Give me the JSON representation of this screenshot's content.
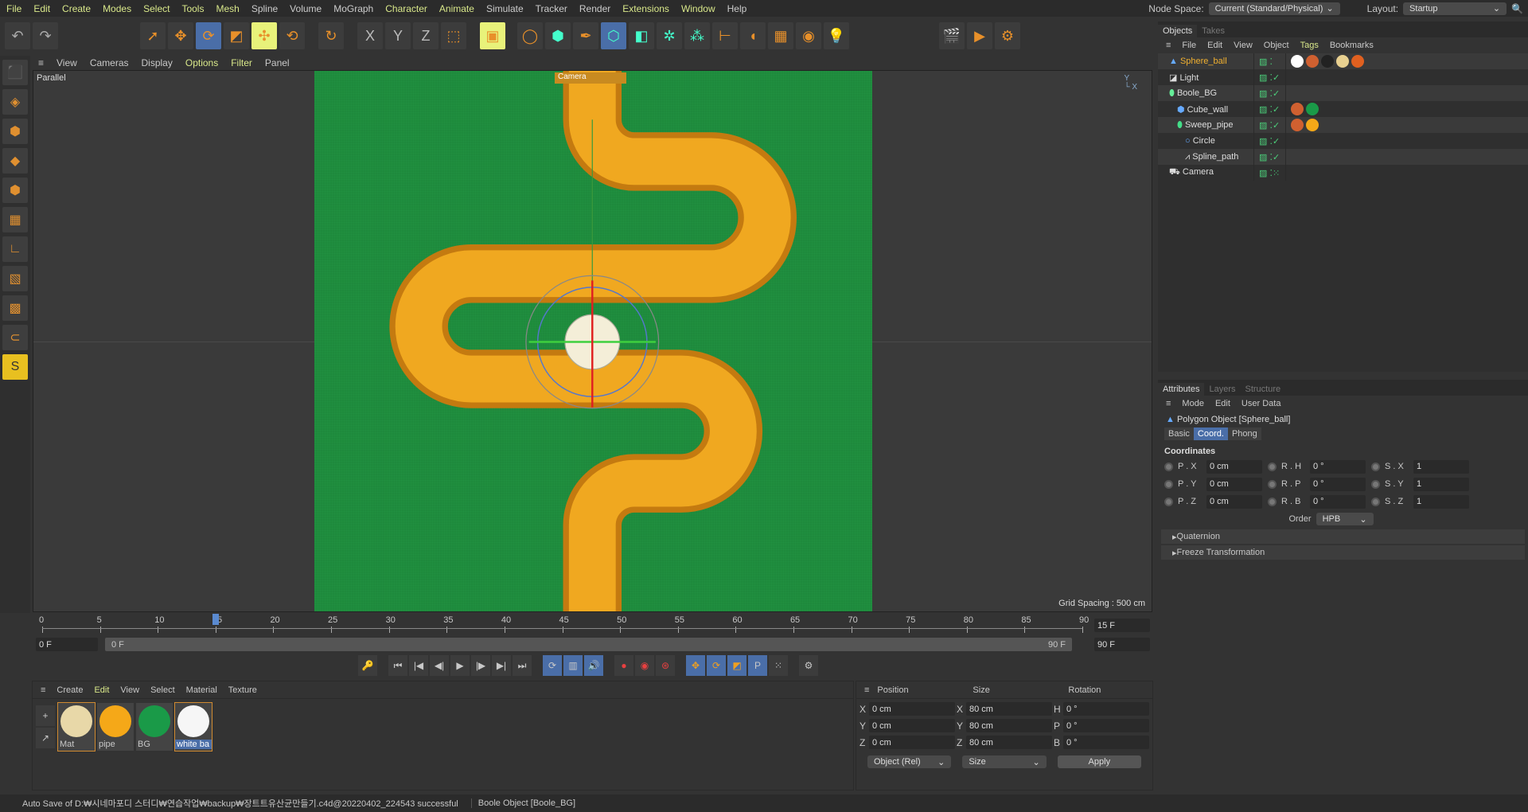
{
  "menu": [
    "File",
    "Edit",
    "Create",
    "Modes",
    "Select",
    "Tools",
    "Mesh",
    "Spline",
    "Volume",
    "MoGraph",
    "Character",
    "Animate",
    "Simulate",
    "Tracker",
    "Render",
    "Extensions",
    "Window",
    "Help"
  ],
  "menu_highlight": [
    "File",
    "Edit",
    "Create",
    "Modes",
    "Select",
    "Tools",
    "Mesh",
    "Character",
    "Animate",
    "Extensions",
    "Window"
  ],
  "node_space": {
    "label": "Node Space:",
    "value": "Current (Standard/Physical)"
  },
  "layout": {
    "label": "Layout:",
    "value": "Startup"
  },
  "toolbar": {
    "groups": [
      [
        "undo-icon",
        "redo-icon"
      ],
      [
        "live-select-icon",
        "move-icon",
        "rotate-icon",
        "scale-icon",
        "axis-move-icon",
        "transform-icon"
      ],
      [
        "recent-rotate-icon"
      ],
      [
        "x-axis-icon",
        "y-axis-icon",
        "z-axis-icon",
        "coordinate-system-icon"
      ],
      [
        "render-region-icon"
      ],
      [
        "spline-pen-icon",
        "cube-icon",
        "pen-icon",
        "subdivision-icon",
        "extrude-icon",
        "cloner-icon",
        "array-icon",
        "symmetry-icon",
        "deformer-icon",
        "floor-icon",
        "camera-icon",
        "light-icon"
      ],
      [
        "render-view-icon",
        "render-icon",
        "render-settings-icon"
      ]
    ],
    "glyphs": {
      "undo-icon": "↶",
      "redo-icon": "↷",
      "live-select-icon": "➚",
      "move-icon": "✥",
      "rotate-icon": "⟳",
      "scale-icon": "◩",
      "axis-move-icon": "✣",
      "transform-icon": "⟲",
      "recent-rotate-icon": "↻",
      "x-axis-icon": "X",
      "y-axis-icon": "Y",
      "z-axis-icon": "Z",
      "coordinate-system-icon": "⬚",
      "render-region-icon": "▣",
      "spline-pen-icon": "◯",
      "cube-icon": "⬢",
      "pen-icon": "✒",
      "subdivision-icon": "⬡",
      "extrude-icon": "◧",
      "cloner-icon": "✲",
      "array-icon": "⁂",
      "symmetry-icon": "⊢",
      "deformer-icon": "◖",
      "floor-icon": "▦",
      "camera-icon": "◉",
      "light-icon": "💡",
      "render-view-icon": "🎬",
      "render-icon": "▶",
      "render-settings-icon": "⚙"
    }
  },
  "left_tools": [
    "⬛",
    "◈",
    "⬢",
    "◆",
    "⬢",
    "▦",
    "∟",
    "▧",
    "▩",
    "⊂",
    "S"
  ],
  "viewport": {
    "menu": [
      "View",
      "Cameras",
      "Display",
      "Options",
      "Filter",
      "Panel"
    ],
    "highlight": [
      "Options",
      "Filter"
    ],
    "projection": "Parallel",
    "camera": "Camera",
    "grid_spacing": "Grid Spacing : 500 cm"
  },
  "colors": {
    "pipe": "#f0a820",
    "field": "#1e8a3c",
    "accent": "#4a6ea8",
    "highlight": "#d9e88a"
  },
  "timeline": {
    "ticks": [
      0,
      5,
      10,
      15,
      20,
      25,
      30,
      35,
      40,
      45,
      50,
      55,
      60,
      65,
      70,
      75,
      80,
      85,
      90
    ],
    "current_frame": 15,
    "current_label": "15 F",
    "start": "0 F",
    "range_start": "0 F",
    "range_end": "90 F",
    "end": "90 F"
  },
  "transport": [
    "key-icon",
    "first-frame-icon",
    "prev-key-icon",
    "prev-frame-icon",
    "play-icon",
    "next-frame-icon",
    "next-key-icon",
    "last-frame-icon",
    "loop-icon",
    "film-icon",
    "sound-icon",
    "record-icon",
    "autokey-icon",
    "keyframe-icon",
    "pos-key-icon",
    "rot-key-icon",
    "scale-key-icon",
    "param-key-icon",
    "pla-key-icon",
    "motion-icon"
  ],
  "materials": {
    "menu": [
      "Create",
      "Edit",
      "View",
      "Select",
      "Material",
      "Texture"
    ],
    "highlight": "Edit",
    "items": [
      {
        "name": "Mat",
        "color": "#e8d8a8"
      },
      {
        "name": "pipe",
        "color": "#f5a818"
      },
      {
        "name": "BG",
        "color": "#1a9a48"
      },
      {
        "name": "white ba",
        "color": "#f6f6f6"
      }
    ]
  },
  "coords": {
    "headers": [
      "Position",
      "Size",
      "Rotation"
    ],
    "rows": [
      [
        "X",
        "0 cm",
        "X",
        "80 cm",
        "H",
        "0 °"
      ],
      [
        "Y",
        "0 cm",
        "Y",
        "80 cm",
        "P",
        "0 °"
      ],
      [
        "Z",
        "0 cm",
        "Z",
        "80 cm",
        "B",
        "0 °"
      ]
    ],
    "mode": "Object (Rel)",
    "size_mode": "Size",
    "apply": "Apply"
  },
  "status": {
    "message": "Auto Save of D:₩시네마포디 스터디₩연습작업₩backup₩장트트유산균만들기.c4d@20220402_224543 successful",
    "selection": "Boole Object [Boole_BG]"
  },
  "objects": {
    "tabs": [
      "Objects",
      "Takes"
    ],
    "menu": [
      "File",
      "Edit",
      "View",
      "Object",
      "Tags",
      "Bookmarks"
    ],
    "highlight": "Tags",
    "items": [
      {
        "name": "Sphere_ball",
        "indent": 0,
        "icon": "polygon-icon",
        "selected": true,
        "check": "",
        "tags": [
          "#ffffff",
          "#d06030",
          "#222",
          "#e8d090",
          "#e06020"
        ]
      },
      {
        "name": "Light",
        "indent": 0,
        "icon": "light-icon",
        "check": "✓",
        "tags": []
      },
      {
        "name": "Boole_BG",
        "indent": 0,
        "icon": "boole-icon",
        "check": "✓",
        "tags": []
      },
      {
        "name": "Cube_wall",
        "indent": 1,
        "icon": "cube-icon",
        "check": "✓",
        "tags": [
          "#d06030",
          "#1a9a48"
        ]
      },
      {
        "name": "Sweep_pipe",
        "indent": 1,
        "icon": "sweep-icon",
        "check": "✓",
        "tags": [
          "#d06030",
          "#f5a818"
        ]
      },
      {
        "name": "Circle",
        "indent": 2,
        "icon": "circle-icon",
        "check": "✓",
        "tags": []
      },
      {
        "name": "Spline_path",
        "indent": 2,
        "icon": "spline-icon",
        "check": "✓",
        "tags": []
      },
      {
        "name": "Camera",
        "indent": 0,
        "icon": "camera-icon",
        "check": "⁙",
        "tags": []
      }
    ]
  },
  "attributes": {
    "tabs": [
      "Attributes",
      "Layers",
      "Structure"
    ],
    "menu": [
      "Mode",
      "Edit",
      "User Data"
    ],
    "title": "Polygon Object [Sphere_ball]",
    "subtabs": [
      "Basic",
      "Coord.",
      "Phong"
    ],
    "active_subtab": "Coord.",
    "section": "Coordinates",
    "rows": [
      [
        [
          "P . X",
          "0 cm"
        ],
        [
          "R . H",
          "0 °"
        ],
        [
          "S . X",
          "1"
        ]
      ],
      [
        [
          "P . Y",
          "0 cm"
        ],
        [
          "R . P",
          "0 °"
        ],
        [
          "S . Y",
          "1"
        ]
      ],
      [
        [
          "P . Z",
          "0 cm"
        ],
        [
          "R . B",
          "0 °"
        ],
        [
          "S . Z",
          "1"
        ]
      ]
    ],
    "order_label": "Order",
    "order": "HPB",
    "folds": [
      "Quaternion",
      "Freeze Transformation"
    ]
  }
}
